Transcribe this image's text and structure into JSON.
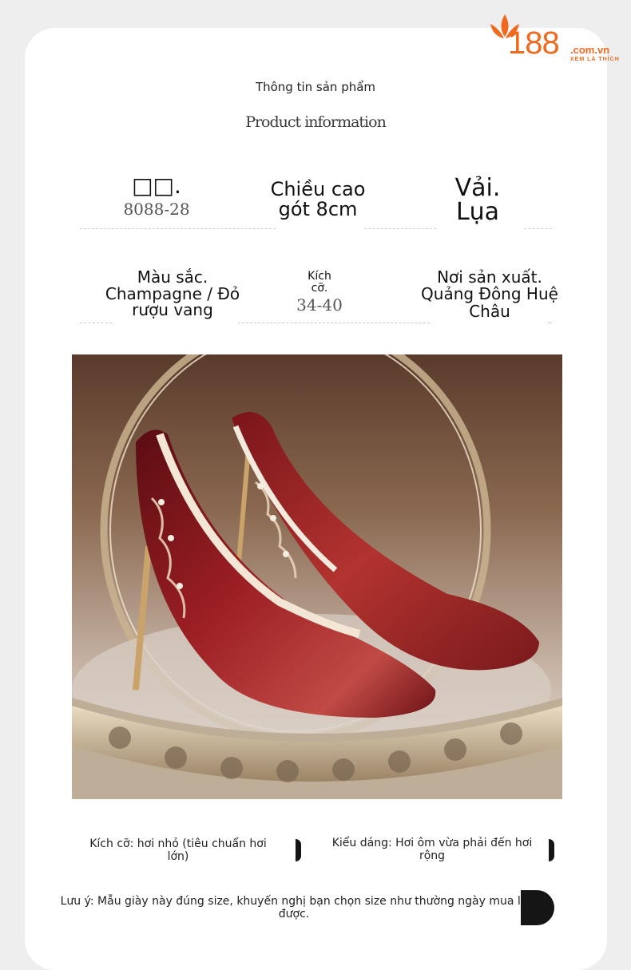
{
  "brand": {
    "number": "188",
    "domain": ".com.vn",
    "tagline": "XEM LÀ THÍCH",
    "color": "#ef6a1f"
  },
  "header": {
    "title_vi": "Thông tin sản phẩm",
    "title_en": "Product information"
  },
  "specs": {
    "model": {
      "label": "□□.",
      "value": "8088-28"
    },
    "heel": {
      "label_line1": "Chiều cao",
      "label_line2": "gót 8cm"
    },
    "fabric": {
      "label_line1": "Vải.",
      "label_line2": "Lụa"
    },
    "color": {
      "label_line1": "Màu sắc.",
      "label_line2": "Champagne / Đỏ",
      "label_line3": "rượu vang"
    },
    "size": {
      "label_line1": "Kích",
      "label_line2": "cỡ.",
      "value": "34-40"
    },
    "origin": {
      "label_line1": "Nơi sản xuất.",
      "label_line2": "Quảng Đông Huệ",
      "label_line3": "Châu"
    }
  },
  "notes": {
    "size_fit": "Kích cỡ: hơi nhỏ (tiêu chuẩn hơi lớn)",
    "style_fit": "Kiểu dáng: Hơi ôm vừa phải đến hơi rộng",
    "warning": "Lưu ý: Mẫu giày này đúng size, khuyến nghị bạn chọn size như thường ngày mua là được."
  },
  "product_image": {
    "subject": "wine-red satin embroidered pointed-toe stiletto pumps on a gold display stand"
  }
}
